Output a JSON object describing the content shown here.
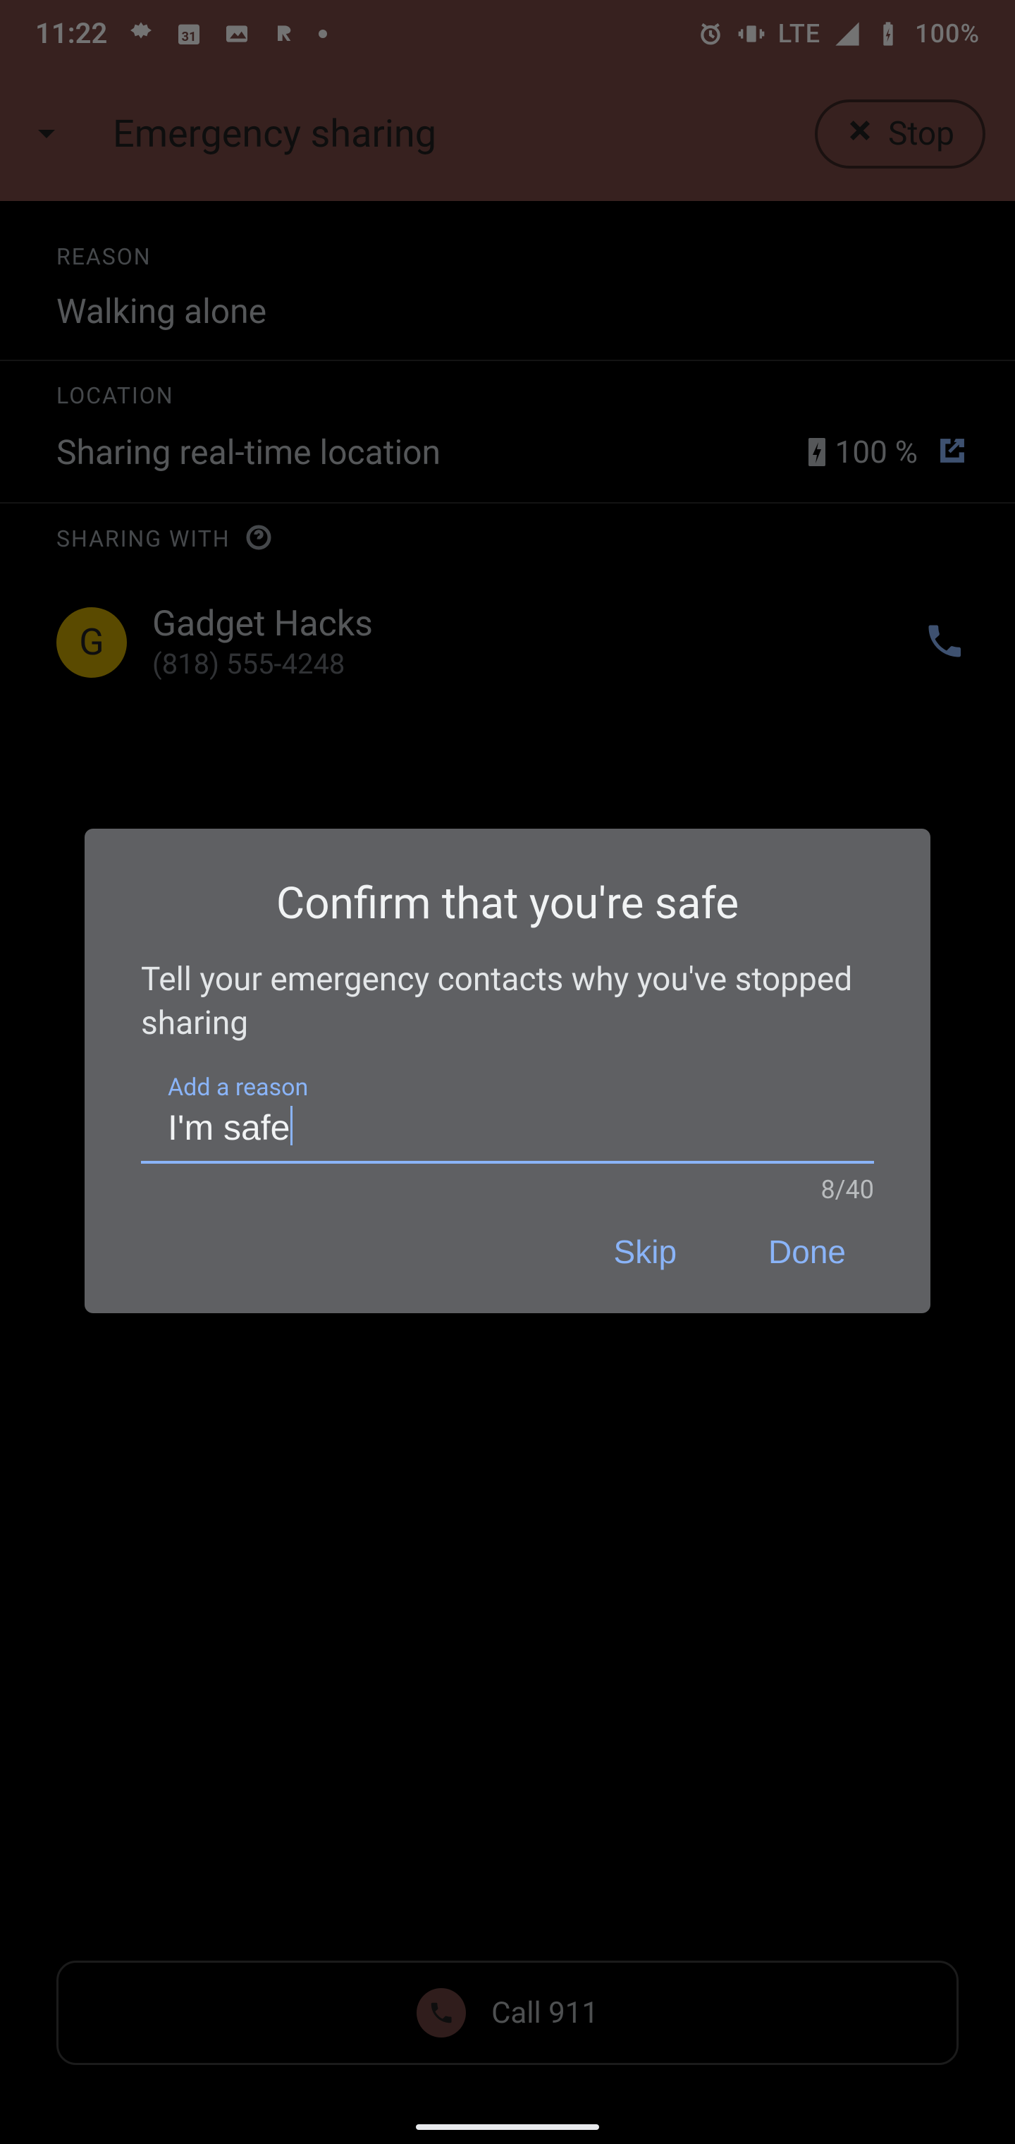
{
  "statusbar": {
    "time": "11:22",
    "lte": "LTE",
    "battery": "100%"
  },
  "appbar": {
    "title": "Emergency sharing",
    "stop": "Stop"
  },
  "reason": {
    "label": "REASON",
    "value": "Walking alone"
  },
  "location": {
    "label": "LOCATION",
    "value": "Sharing real-time location",
    "battery": "100 %"
  },
  "sharing_with": {
    "label": "SHARING WITH"
  },
  "contact": {
    "initial": "G",
    "name": "Gadget Hacks",
    "phone": "(818) 555-4248"
  },
  "call": {
    "label": "Call 911"
  },
  "dialog": {
    "title": "Confirm that you're safe",
    "subtitle": "Tell your emergency contacts why you've stopped sharing",
    "input_label": "Add a reason",
    "input_value": "I'm safe",
    "counter": "8/40",
    "skip": "Skip",
    "done": "Done"
  }
}
